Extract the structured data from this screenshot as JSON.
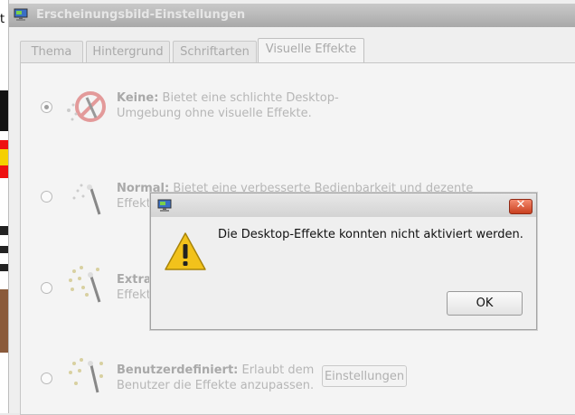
{
  "background_page": {
    "fragment": "t"
  },
  "window": {
    "title": "Erscheinungsbild-Einstellungen",
    "tabs": [
      {
        "label": "Thema"
      },
      {
        "label": "Hintergrund"
      },
      {
        "label": "Schriftarten"
      },
      {
        "label": "Visuelle Effekte",
        "active": true
      }
    ],
    "options": [
      {
        "name": "Keine:",
        "desc1": " Bietet eine schlichte Desktop-",
        "desc2": "Umgebung ohne visuelle Effekte.",
        "checked": true
      },
      {
        "name": "Normal:",
        "desc1": " Bietet eine verbesserte Bedienbarkeit und dezente",
        "desc2": "Effekte",
        "checked": false
      },
      {
        "name": "Extra:",
        "desc1": "",
        "desc2": "Effekte",
        "checked": false
      },
      {
        "name": "Benutzerdefiniert:",
        "desc1": " Erlaubt dem",
        "desc2": "Benutzer die Effekte anzupassen.",
        "checked": false
      }
    ],
    "settings_button": "Einstellungen"
  },
  "dialog": {
    "message": "Die Desktop-Effekte konnten nicht aktiviert werden.",
    "ok_label": "OK",
    "close_glyph": "✕"
  },
  "icons": {
    "window_icon": "monitor-icon",
    "warning": "warning-icon"
  },
  "colors": {
    "warning_yellow": "#f2c21b",
    "close_red": "#d5502d"
  }
}
